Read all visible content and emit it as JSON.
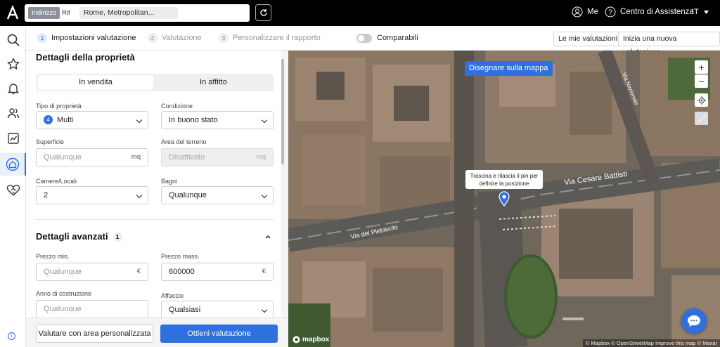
{
  "topbar": {
    "search_tab_active": "Indirizzo",
    "search_tab_other": "Rif",
    "search_value": "Rome, Metropolitan...",
    "user_label": "Me",
    "help_label": "Centro di Assistenza",
    "lang": "IT"
  },
  "sidebar": {
    "items": [
      "search-icon",
      "star-icon",
      "bell-icon",
      "users-icon",
      "chart-icon",
      "home-valuation-icon",
      "handshake-icon"
    ],
    "active": "home-valuation-icon"
  },
  "steps": [
    {
      "num": "1",
      "label": "Impostazioni valutazione"
    },
    {
      "num": "2",
      "label": "Valutazione"
    },
    {
      "num": "3",
      "label": "Personalizzare il rapporto"
    }
  ],
  "comparabili": {
    "label": "Comparabili",
    "on": false
  },
  "header_buttons": {
    "my": "Le mie valutazioni",
    "new": "Inizia una nuova valutazione"
  },
  "details": {
    "title": "Dettagli della proprietà",
    "sale": "In vendita",
    "rent": "In affitto",
    "type_label": "Tipo di proprietà",
    "type_badge": "4",
    "type_value": "Multi",
    "condition_label": "Condizione",
    "condition_value": "In buono stato",
    "surface_label": "Superficie",
    "surface_ph": "Qualunque",
    "surface_unit": "mq",
    "land_label": "Area del terreno",
    "land_value": "Disattivato",
    "land_unit": "mq",
    "rooms_label": "Camere/Locali",
    "rooms_value": "2",
    "baths_label": "Bagni",
    "baths_value": "Qualunque"
  },
  "advanced": {
    "title": "Dettagli avanzati",
    "count": "1",
    "min_label": "Prezzo min.",
    "min_ph": "Qualunque",
    "min_unit": "€",
    "max_label": "Prezzo mass.",
    "max_value": "600000",
    "max_unit": "€",
    "year_label": "Anno di costruzione",
    "year_ph": "Qualunque",
    "view_label": "Affaccio",
    "view_value": "Qualsiasi"
  },
  "footer": {
    "custom": "Valutare con area personalizzata",
    "get": "Ottieni valutazione"
  },
  "map": {
    "draw_button": "Disegnare sulla mappa",
    "tooltip_line1": "Trascina e rilascia il pin per",
    "tooltip_line2": "definire la posizione",
    "street1": "Via Cesare Battisti",
    "street2": "Via del Plebiscito",
    "street3": "Via Nazionale",
    "logo": "mapbox",
    "attribution": "© Mapbox © OpenStreetMap Improve this map © Maxar"
  },
  "colors": {
    "accent": "#2f6fde"
  }
}
